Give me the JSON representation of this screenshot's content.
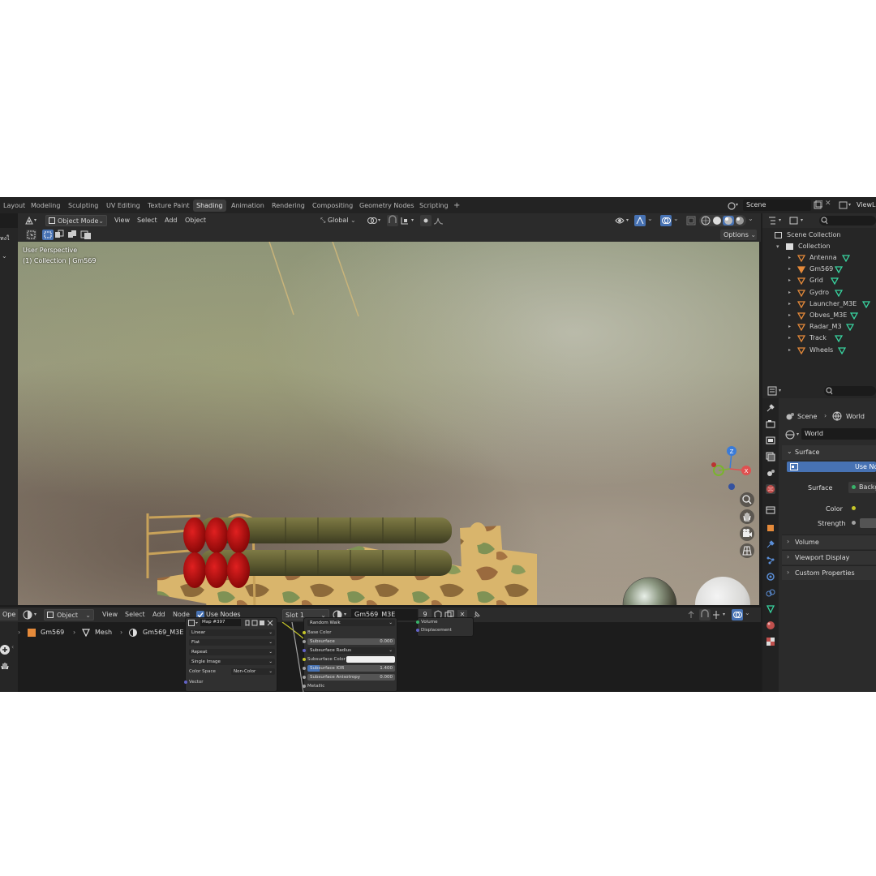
{
  "workspaces": [
    "Layout",
    "Modeling",
    "Sculpting",
    "UV Editing",
    "Texture Paint",
    "Shading",
    "Animation",
    "Rendering",
    "Compositing",
    "Geometry Nodes",
    "Scripting"
  ],
  "active_workspace": "Shading",
  "add_tab": "+",
  "scene": {
    "label": "Scene",
    "view_layer": "ViewL"
  },
  "viewport": {
    "mode": "Object Mode",
    "menus": [
      "View",
      "Select",
      "Add",
      "Object"
    ],
    "transform_orientation": "Global",
    "options": "Options",
    "overlay_title": "User Perspective",
    "overlay_subtitle": "(1) Collection | Gm569",
    "left_clip": [
      "ทงใ"
    ],
    "gizmo": {
      "z": "Z",
      "x": "X"
    }
  },
  "outliner": {
    "scene_collection": "Scene Collection",
    "collection": "Collection",
    "items": [
      "Antenna",
      "Gm569",
      "Grid",
      "Gydro",
      "Launcher_M3E",
      "Obves_M3E",
      "Radar_M3",
      "Track",
      "Wheels"
    ]
  },
  "properties": {
    "breadcrumb": {
      "scene": "Scene",
      "world": "World"
    },
    "world_name": "World",
    "surface_panel": "Surface",
    "use_nodes": "Use No",
    "surface_label": "Surface",
    "surface_value": "Backg",
    "color_label": "Color",
    "strength_label": "Strength",
    "panels": [
      "Volume",
      "Viewport Display",
      "Custom Properties"
    ]
  },
  "node_editor": {
    "open_clip": "Ope",
    "object_select": "Object",
    "menus": [
      "View",
      "Select",
      "Add",
      "Node"
    ],
    "use_nodes": "Use Nodes",
    "slot": "Slot 1",
    "material": "Gm569_M3E",
    "users": "9",
    "breadcrumb": [
      "Gm569",
      "Mesh",
      "Gm569_M3E"
    ],
    "image_node": {
      "title": "Map #397",
      "rows": [
        "Linear",
        "Flat",
        "Repeat",
        "Single Image"
      ],
      "color_space_label": "Color Space",
      "color_space_value": "Non-Color",
      "vector": "Vector"
    },
    "bsdf_node": {
      "subsurface_method": "Random Walk",
      "base_color": "Base Color",
      "subsurface": "Subsurface",
      "subsurface_value": "0.000",
      "subsurface_radius": "Subsurface Radius",
      "subsurface_color": "Subsurface Color",
      "subsurface_ior": "Subsurface IOR",
      "subsurface_ior_value": "1.400",
      "subsurface_anisotropy": "Subsurface Anisotropy",
      "subsurface_anisotropy_value": "0.000",
      "metallic": "Metallic"
    },
    "output_node": {
      "volume": "Volume",
      "displacement": "Displacement"
    }
  },
  "colors": {
    "accent": "#4772b3",
    "object_icon": "#e58a3a",
    "mesh_icon": "#38d39f",
    "active_tab": "#3d3d3d"
  }
}
